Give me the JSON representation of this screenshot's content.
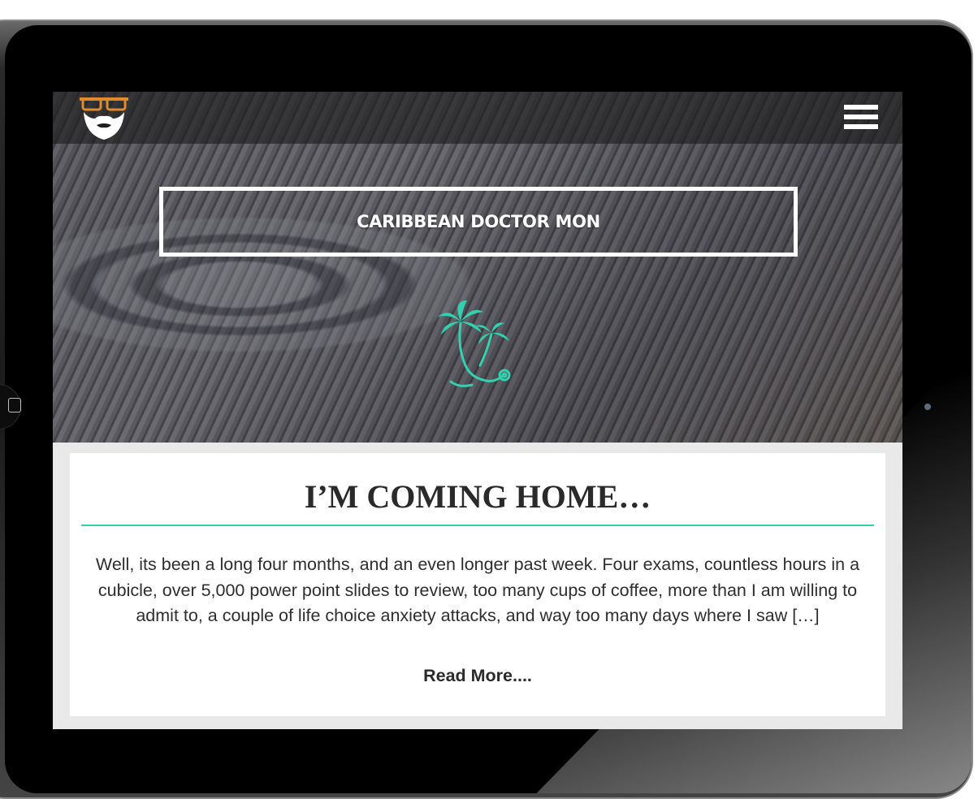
{
  "header": {
    "logo_icon": "bearded-man-glasses-logo",
    "menu_icon": "hamburger-menu-icon"
  },
  "hero": {
    "site_title": "CARIBBEAN DOCTOR MON",
    "emblem_icon": "palm-tree-stethoscope-icon"
  },
  "post": {
    "title": "I’M COMING HOME…",
    "excerpt": "Well, its been a long four months, and an even longer past week. Four exams, countless hours in a cubicle, over 5,000 power point slides to review, too many cups of coffee, more than I am willing to admit to, a couple of life choice anxiety attacks, and way too many days where I saw […]",
    "read_more": "Read More...."
  },
  "colors": {
    "accent": "#34d1b0",
    "logo_glasses": "#e08a2c",
    "text": "#2a2a2a"
  }
}
